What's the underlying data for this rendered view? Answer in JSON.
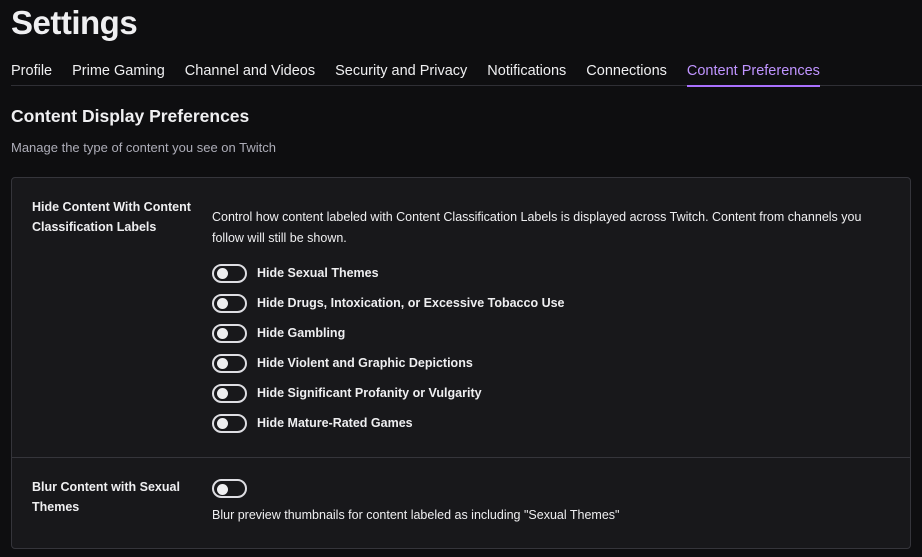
{
  "header": {
    "title": "Settings"
  },
  "tabs": [
    {
      "label": "Profile",
      "active": false
    },
    {
      "label": "Prime Gaming",
      "active": false
    },
    {
      "label": "Channel and Videos",
      "active": false
    },
    {
      "label": "Security and Privacy",
      "active": false
    },
    {
      "label": "Notifications",
      "active": false
    },
    {
      "label": "Connections",
      "active": false
    },
    {
      "label": "Content Preferences",
      "active": true
    }
  ],
  "colors": {
    "accent": "#bf94ff",
    "accent_underline": "#a970ff",
    "background": "#0e0e10",
    "card": "#18181b"
  },
  "section": {
    "title": "Content Display Preferences",
    "subtitle": "Manage the type of content you see on Twitch"
  },
  "hide_content": {
    "label": "Hide Content With Content Classification Labels",
    "description": "Control how content labeled with Content Classification Labels is displayed across Twitch. Content from channels you follow will still be shown.",
    "toggles": [
      {
        "label": "Hide Sexual Themes",
        "on": false
      },
      {
        "label": "Hide Drugs, Intoxication, or Excessive Tobacco Use",
        "on": false
      },
      {
        "label": "Hide Gambling",
        "on": false
      },
      {
        "label": "Hide Violent and Graphic Depictions",
        "on": false
      },
      {
        "label": "Hide Significant Profanity or Vulgarity",
        "on": false
      },
      {
        "label": "Hide Mature-Rated Games",
        "on": false
      }
    ]
  },
  "blur_content": {
    "label": "Blur Content with Sexual Themes",
    "on": false,
    "description": "Blur preview thumbnails for content labeled as including \"Sexual Themes\""
  }
}
